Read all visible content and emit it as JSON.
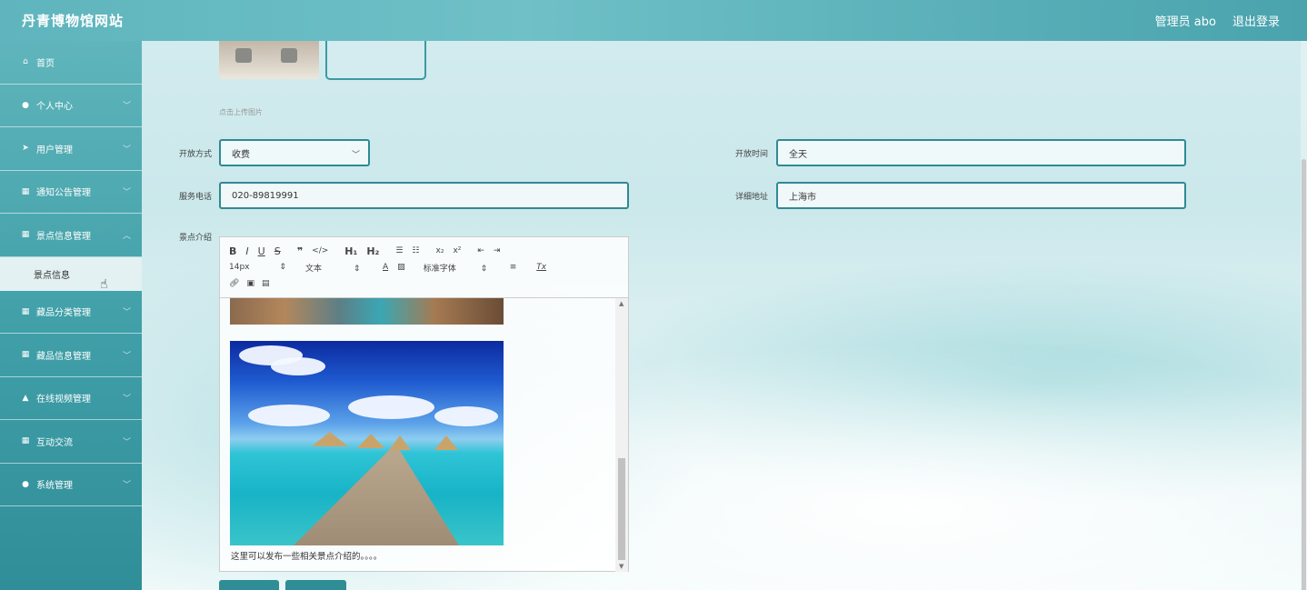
{
  "header": {
    "title": "丹青博物馆网站",
    "user": "管理员 abo",
    "logout": "退出登录"
  },
  "sidebar": {
    "items": [
      {
        "label": "首页",
        "icon": "home-icon",
        "glyph": "⌂",
        "chevron": false
      },
      {
        "label": "个人中心",
        "icon": "user-icon",
        "glyph": "●",
        "chevron": true
      },
      {
        "label": "用户管理",
        "icon": "send-icon",
        "glyph": "➤",
        "chevron": true
      },
      {
        "label": "通知公告管理",
        "icon": "grid-icon",
        "glyph": "▦",
        "chevron": true
      },
      {
        "label": "景点信息管理",
        "icon": "grid-icon",
        "glyph": "▦",
        "chevron": true,
        "expanded": true
      },
      {
        "label": "藏品分类管理",
        "icon": "grid-icon",
        "glyph": "▦",
        "chevron": true
      },
      {
        "label": "藏品信息管理",
        "icon": "grid-icon",
        "glyph": "▦",
        "chevron": true
      },
      {
        "label": "在线视频管理",
        "icon": "person-icon",
        "glyph": "▲",
        "chevron": true
      },
      {
        "label": "互动交流",
        "icon": "grid-icon",
        "glyph": "▦",
        "chevron": true
      },
      {
        "label": "系统管理",
        "icon": "bulb-icon",
        "glyph": "●",
        "chevron": true
      }
    ],
    "submenu_label": "景点信息"
  },
  "form": {
    "upload_hint": "点击上传图片",
    "open_mode": {
      "label": "开放方式",
      "value": "收费"
    },
    "open_time": {
      "label": "开放时间",
      "value": "全天"
    },
    "phone": {
      "label": "服务电话",
      "value": "020-89819991"
    },
    "address": {
      "label": "详细地址",
      "value": "上海市"
    },
    "intro": {
      "label": "景点介绍",
      "font_size": "14px",
      "text_style": "文本",
      "font_family": "标准字体",
      "content_text": "这里可以发布一些相关景点介绍的。。。。"
    }
  }
}
